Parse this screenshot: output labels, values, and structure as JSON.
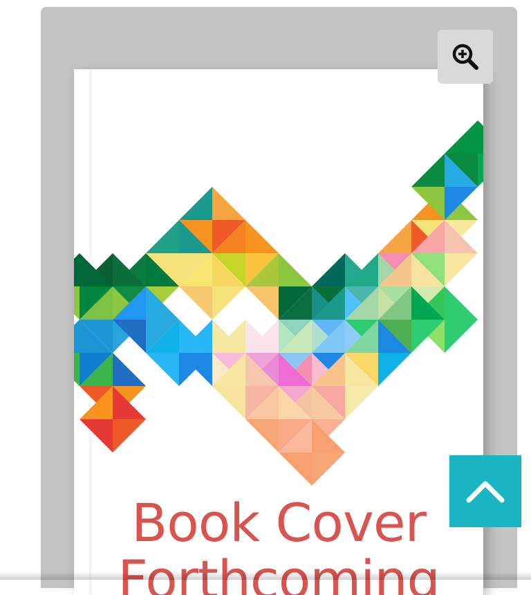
{
  "cover": {
    "title_line1": "Book Cover",
    "title_line2": "Forthcoming",
    "title_color": "#d9534f"
  },
  "zoom_button": {
    "icon": "zoom-in-icon"
  },
  "scroll_top_button": {
    "icon": "chevron-up-icon",
    "color": "#1ab5c3"
  },
  "colors": {
    "frame": "#c4c4c4",
    "zoom_bg": "#d9d9d9"
  }
}
